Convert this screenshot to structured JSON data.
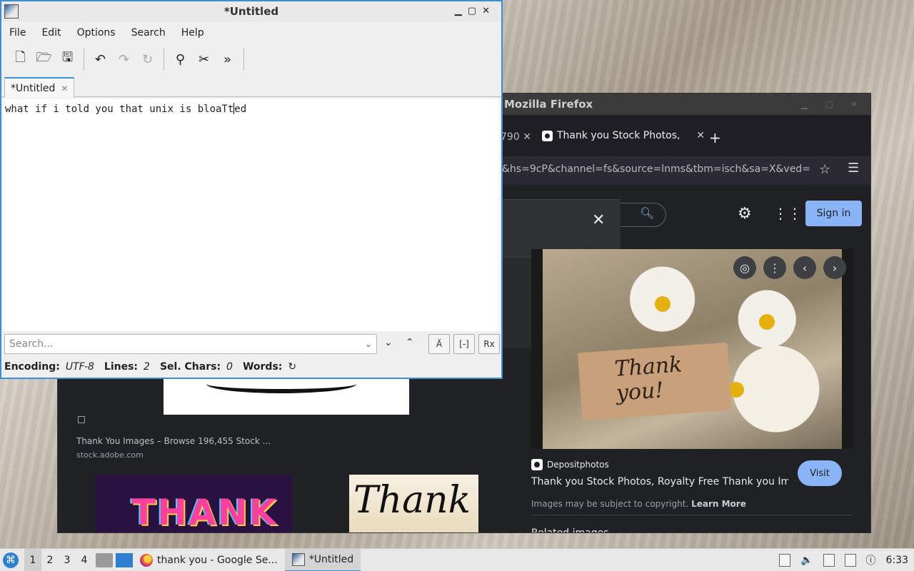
{
  "firefox": {
    "title": "Mozilla Firefox",
    "tab_fragment": "790",
    "tab_title": "Thank you Stock Photos,",
    "url": "&hs=9cP&channel=fs&source=lnms&tbm=isch&sa=X&ved=",
    "signin_label": "Sign in",
    "preview_tag_text": "Thank you!",
    "source_name": "Depositphotos",
    "preview_title": "Thank you Stock Photos, Royalty Free Thank you Im...",
    "visit_label": "Visit",
    "copyright_text": "Images may be subject to copyright.",
    "learn_more": "Learn More",
    "related_label": "Related images",
    "result_title": "Thank You Images – Browse 196,455 Stock ...",
    "result_site": "stock.adobe.com",
    "thumb1_text": "THANK",
    "thumb2_text": "Thank"
  },
  "featherpad": {
    "title": "*Untitled",
    "menu": [
      "File",
      "Edit",
      "Options",
      "Search",
      "Help"
    ],
    "tab_label": "*Untitled",
    "editor_text_before_caret": "what if i told you that unix is bloaTt",
    "editor_text_after_caret": "ed",
    "search_placeholder": "Search...",
    "status": {
      "encoding_label": "Encoding:",
      "encoding_value": "UTF-8",
      "lines_label": "Lines:",
      "lines_value": "2",
      "sel_label": "Sel. Chars:",
      "sel_value": "0",
      "words_label": "Words:"
    }
  },
  "taskbar": {
    "desktops": [
      "1",
      "2",
      "3",
      "4"
    ],
    "tasks": [
      {
        "label": "thank you - Google Se..."
      },
      {
        "label": "*Untitled"
      }
    ],
    "clock": "6:33"
  }
}
